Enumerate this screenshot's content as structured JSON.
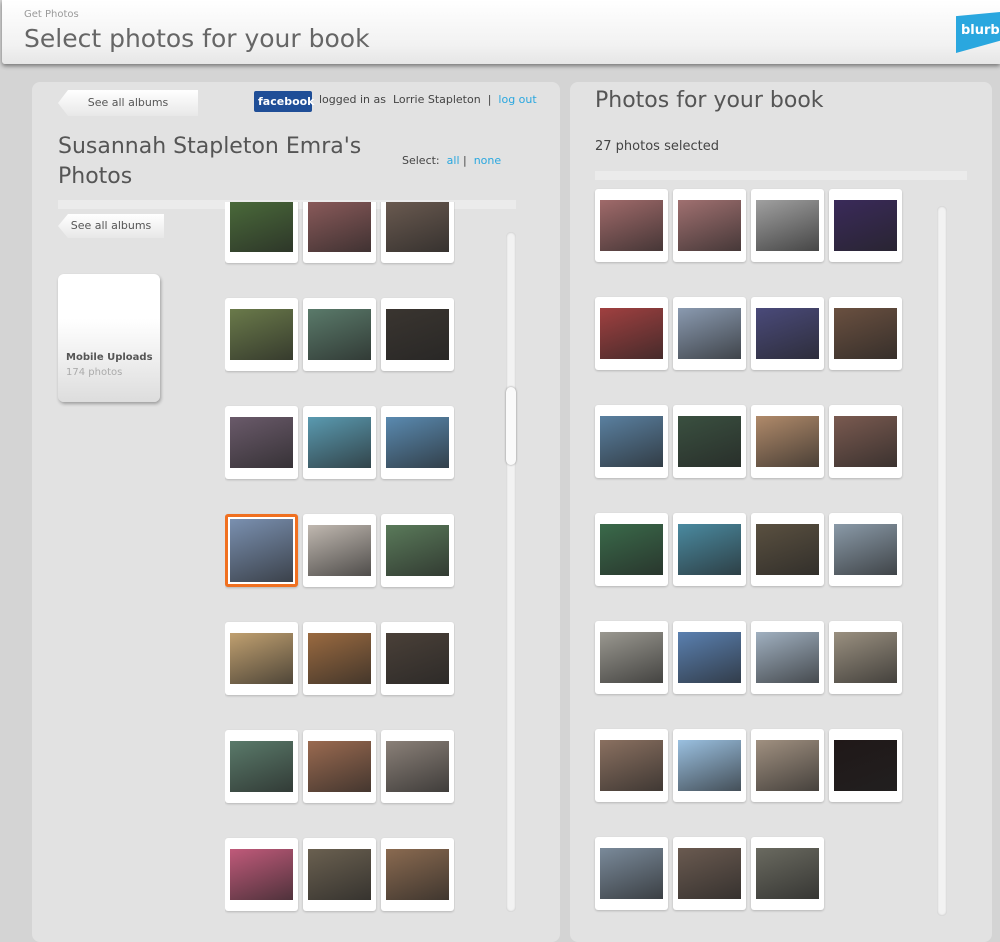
{
  "header": {
    "breadcrumb": "Get Photos",
    "title": "Select photos for your book",
    "logo": "blurb"
  },
  "left": {
    "see_all_top": "See all albums",
    "see_all_side": "See all albums",
    "facebook": "facebook",
    "logged_in_as": "logged in as",
    "user": "Lorrie Stapleton",
    "separator": "|",
    "logout": "log out",
    "album_title": "Susannah Stapleton Emra's Photos",
    "select_label": "Select:",
    "select_all": "all",
    "select_none": "none",
    "album": {
      "name": "Mobile Uploads",
      "count": "174 photos"
    },
    "selected_index": 9,
    "photos": [
      "#4a6a3a",
      "#8a5a5a",
      "#6a5a50",
      "#6a7a4a",
      "#5a7a6a",
      "#3a3530",
      "#6a5a6a",
      "#5a9ab0",
      "#5a8ab0",
      "#7a90b0",
      "#c0b8b0",
      "#5a7a5a",
      "#c0a070",
      "#9a6a40",
      "#4a4038",
      "#5a7a6a",
      "#9a6a50",
      "#8a8078",
      "#c05a7a",
      "#6a6050",
      "#8a6a50"
    ]
  },
  "right": {
    "title": "Photos for your book",
    "count": "27 photos selected",
    "photos": [
      "#a06a6a",
      "#a07070",
      "#a0a0a0",
      "#3a2a5a",
      "#a04040",
      "#8a9ab0",
      "#4a4a7a",
      "#6a5040",
      "#5a80a0",
      "#3a5040",
      "#b08a6a",
      "#7a5a50",
      "#3a6a4a",
      "#4a8aa0",
      "#5a5040",
      "#8a9aa8",
      "#9a9890",
      "#5a80b0",
      "#a0b0c0",
      "#9a9080",
      "#8a7060",
      "#9ac0e0",
      "#a09080",
      "#201818",
      "#7a8a9a",
      "#6a5a50",
      "#6a6a60"
    ]
  }
}
